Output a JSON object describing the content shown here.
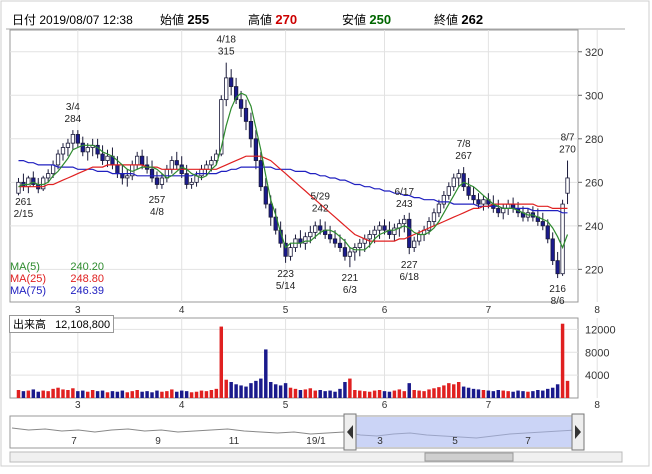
{
  "header": {
    "datetime_label": "日付",
    "datetime": "2019/08/07 12:38",
    "open_label": "始値",
    "open": "255",
    "high_label": "高値",
    "high": "270",
    "low_label": "安値",
    "low": "250",
    "close_label": "終値",
    "close": "262"
  },
  "colors": {
    "up": "#ffffff",
    "down": "#1a1a8c",
    "ma5": "#2e8b2e",
    "ma25": "#e02020",
    "ma75": "#2020c0",
    "vol_up": "#e02020",
    "vol_down": "#1a1a8c",
    "high_text": "#cc0000",
    "low_text": "#006600"
  },
  "ma_legend": [
    {
      "label": "MA(5)",
      "value": "240.20",
      "color": "#2e8b2e"
    },
    {
      "label": "MA(25)",
      "value": "248.80",
      "color": "#e02020"
    },
    {
      "label": "MA(75)",
      "value": "246.39",
      "color": "#2020c0"
    }
  ],
  "volume_label": {
    "label": "出来高",
    "value": "12,108,800"
  },
  "chart_data": {
    "type": "candlestick",
    "ylim": [
      205,
      330
    ],
    "yticks": [
      220,
      240,
      260,
      280,
      300,
      320
    ],
    "vol_ylim": [
      0,
      14000
    ],
    "vol_yticks": [
      4000,
      8000,
      12000
    ],
    "month_ticks": [
      {
        "label": "3",
        "index": 12
      },
      {
        "label": "4",
        "index": 33
      },
      {
        "label": "5",
        "index": 54
      },
      {
        "label": "6",
        "index": 74
      },
      {
        "label": "7",
        "index": 95
      },
      {
        "label": "8",
        "index": 117
      }
    ],
    "candles": [
      [
        255,
        262,
        254,
        260
      ],
      [
        260,
        264,
        256,
        258
      ],
      [
        258,
        263,
        255,
        262
      ],
      [
        262,
        265,
        258,
        259
      ],
      [
        259,
        262,
        255,
        257
      ],
      [
        257,
        263,
        256,
        262
      ],
      [
        262,
        266,
        260,
        264
      ],
      [
        264,
        270,
        262,
        268
      ],
      [
        268,
        275,
        266,
        273
      ],
      [
        273,
        278,
        270,
        276
      ],
      [
        276,
        280,
        272,
        278
      ],
      [
        278,
        284,
        275,
        282
      ],
      [
        282,
        284,
        276,
        278
      ],
      [
        278,
        281,
        272,
        274
      ],
      [
        274,
        278,
        270,
        276
      ],
      [
        276,
        280,
        272,
        277
      ],
      [
        277,
        280,
        271,
        273
      ],
      [
        273,
        277,
        268,
        270
      ],
      [
        270,
        275,
        267,
        272
      ],
      [
        272,
        276,
        266,
        268
      ],
      [
        268,
        272,
        262,
        264
      ],
      [
        264,
        268,
        259,
        262
      ],
      [
        262,
        266,
        258,
        263
      ],
      [
        263,
        270,
        261,
        268
      ],
      [
        268,
        274,
        266,
        272
      ],
      [
        272,
        275,
        266,
        268
      ],
      [
        268,
        272,
        264,
        266
      ],
      [
        266,
        270,
        260,
        262
      ],
      [
        262,
        265,
        257,
        259
      ],
      [
        259,
        264,
        257,
        262
      ],
      [
        262,
        268,
        260,
        266
      ],
      [
        266,
        272,
        264,
        270
      ],
      [
        270,
        274,
        266,
        268
      ],
      [
        268,
        272,
        262,
        264
      ],
      [
        264,
        268,
        257,
        259
      ],
      [
        259,
        262,
        257,
        260
      ],
      [
        260,
        265,
        258,
        263
      ],
      [
        263,
        268,
        261,
        266
      ],
      [
        266,
        270,
        263,
        268
      ],
      [
        268,
        272,
        265,
        270
      ],
      [
        270,
        275,
        268,
        273
      ],
      [
        273,
        300,
        272,
        298
      ],
      [
        298,
        315,
        295,
        308
      ],
      [
        308,
        312,
        300,
        304
      ],
      [
        304,
        308,
        296,
        298
      ],
      [
        298,
        302,
        290,
        294
      ],
      [
        294,
        298,
        284,
        288
      ],
      [
        288,
        292,
        276,
        280
      ],
      [
        280,
        284,
        266,
        270
      ],
      [
        270,
        274,
        256,
        258
      ],
      [
        258,
        262,
        248,
        250
      ],
      [
        250,
        254,
        240,
        244
      ],
      [
        244,
        248,
        236,
        238
      ],
      [
        238,
        242,
        230,
        232
      ],
      [
        232,
        236,
        223,
        226
      ],
      [
        226,
        232,
        224,
        230
      ],
      [
        230,
        236,
        228,
        234
      ],
      [
        234,
        238,
        230,
        232
      ],
      [
        232,
        237,
        229,
        235
      ],
      [
        235,
        240,
        232,
        237
      ],
      [
        237,
        242,
        234,
        240
      ],
      [
        240,
        243,
        236,
        238
      ],
      [
        238,
        242,
        234,
        236
      ],
      [
        236,
        240,
        232,
        234
      ],
      [
        234,
        238,
        230,
        232
      ],
      [
        232,
        236,
        228,
        230
      ],
      [
        230,
        234,
        224,
        226
      ],
      [
        226,
        230,
        221,
        228
      ],
      [
        228,
        232,
        224,
        230
      ],
      [
        230,
        234,
        226,
        232
      ],
      [
        232,
        236,
        228,
        234
      ],
      [
        234,
        238,
        230,
        236
      ],
      [
        236,
        240,
        232,
        238
      ],
      [
        238,
        242,
        234,
        240
      ],
      [
        240,
        243,
        236,
        238
      ],
      [
        238,
        242,
        234,
        236
      ],
      [
        236,
        241,
        233,
        239
      ],
      [
        239,
        243,
        235,
        241
      ],
      [
        241,
        245,
        237,
        243
      ],
      [
        243,
        246,
        227,
        230
      ],
      [
        230,
        235,
        228,
        233
      ],
      [
        233,
        238,
        231,
        236
      ],
      [
        236,
        240,
        233,
        238
      ],
      [
        238,
        244,
        236,
        242
      ],
      [
        242,
        248,
        240,
        246
      ],
      [
        246,
        252,
        244,
        250
      ],
      [
        250,
        256,
        248,
        254
      ],
      [
        254,
        260,
        252,
        258
      ],
      [
        258,
        264,
        256,
        262
      ],
      [
        262,
        266,
        258,
        264
      ],
      [
        264,
        267,
        256,
        258
      ],
      [
        258,
        262,
        252,
        254
      ],
      [
        254,
        258,
        250,
        252
      ],
      [
        252,
        255,
        248,
        250
      ],
      [
        250,
        254,
        247,
        252
      ],
      [
        252,
        255,
        248,
        250
      ],
      [
        250,
        254,
        246,
        248
      ],
      [
        248,
        252,
        244,
        246
      ],
      [
        246,
        250,
        243,
        248
      ],
      [
        248,
        252,
        245,
        250
      ],
      [
        250,
        253,
        246,
        248
      ],
      [
        248,
        251,
        244,
        246
      ],
      [
        246,
        249,
        242,
        244
      ],
      [
        244,
        248,
        242,
        246
      ],
      [
        246,
        249,
        242,
        244
      ],
      [
        244,
        248,
        240,
        242
      ],
      [
        242,
        246,
        238,
        240
      ],
      [
        240,
        243,
        232,
        234
      ],
      [
        234,
        237,
        222,
        224
      ],
      [
        224,
        228,
        216,
        218
      ],
      [
        218,
        252,
        217,
        250
      ],
      [
        255,
        270,
        250,
        262
      ]
    ],
    "volumes": [
      1400,
      1200,
      1300,
      1500,
      1100,
      1300,
      1200,
      1600,
      1800,
      1500,
      1400,
      1700,
      1200,
      1300,
      1100,
      1400,
      1200,
      1300,
      1000,
      1200,
      1100,
      1300,
      1000,
      1200,
      1400,
      1100,
      1200,
      1000,
      1300,
      1100,
      1200,
      1500,
      1100,
      1300,
      1200,
      1000,
      1100,
      1300,
      1200,
      1400,
      1600,
      12500,
      3200,
      2800,
      2400,
      2200,
      2000,
      2600,
      3000,
      3400,
      8500,
      2800,
      2400,
      2200,
      2600,
      1800,
      1600,
      1400,
      1500,
      1700,
      1300,
      1400,
      1200,
      1300,
      1100,
      1600,
      2800,
      3400,
      1400,
      1300,
      1200,
      1100,
      1300,
      1400,
      1200,
      1100,
      1300,
      1500,
      1200,
      2600,
      1400,
      1300,
      1200,
      1500,
      1700,
      1900,
      2200,
      2600,
      2400,
      2800,
      2000,
      1800,
      1600,
      1500,
      1400,
      1300,
      1200,
      1400,
      1300,
      1200,
      1100,
      1300,
      1200,
      1100,
      1200,
      1400,
      1300,
      1600,
      1800,
      2400,
      13000,
      3000
    ],
    "annotations": [
      {
        "date": "2/15",
        "value": "261",
        "index": 1,
        "pos": "below"
      },
      {
        "date": "3/4",
        "value": "284",
        "index": 11,
        "pos": "above"
      },
      {
        "date": "4/8",
        "value": "257",
        "index": 28,
        "pos": "below"
      },
      {
        "date": "4/18",
        "value": "315",
        "index": 42,
        "pos": "above"
      },
      {
        "date": "5/14",
        "value": "223",
        "index": 54,
        "pos": "below"
      },
      {
        "date": "5/29",
        "value": "242",
        "index": 61,
        "pos": "above"
      },
      {
        "date": "6/3",
        "value": "221",
        "index": 67,
        "pos": "below"
      },
      {
        "date": "6/17",
        "value": "243",
        "index": 78,
        "pos": "above"
      },
      {
        "date": "6/18",
        "value": "227",
        "index": 79,
        "pos": "below"
      },
      {
        "date": "7/8",
        "value": "267",
        "index": 90,
        "pos": "above"
      },
      {
        "date": "8/6",
        "value": "216",
        "index": 109,
        "pos": "below"
      },
      {
        "date": "8/7",
        "value": "270",
        "index": 111,
        "pos": "above"
      }
    ],
    "ma5": [
      258,
      259,
      259,
      260,
      259,
      259,
      260,
      263,
      265,
      268,
      271,
      275,
      276,
      277,
      277,
      277,
      276,
      274,
      273,
      272,
      270,
      268,
      266,
      265,
      266,
      267,
      267,
      267,
      266,
      264,
      262,
      263,
      265,
      267,
      266,
      264,
      263,
      262,
      263,
      266,
      268,
      276,
      286,
      294,
      299,
      301,
      300,
      295,
      285,
      275,
      263,
      252,
      245,
      237,
      230,
      232,
      232,
      232,
      233,
      233,
      235,
      237,
      238,
      238,
      237,
      235,
      233,
      230,
      229,
      229,
      229,
      231,
      234,
      236,
      237,
      238,
      238,
      239,
      240,
      239,
      237,
      236,
      236,
      237,
      239,
      242,
      246,
      250,
      254,
      258,
      260,
      259,
      258,
      256,
      254,
      252,
      250,
      249,
      248,
      248,
      248,
      247,
      246,
      245,
      245,
      244,
      243,
      242,
      239,
      235,
      230,
      236,
      240
    ],
    "ma25": [
      258,
      258,
      258,
      258,
      258,
      258,
      259,
      259,
      260,
      261,
      262,
      263,
      264,
      265,
      266,
      267,
      267,
      267,
      268,
      268,
      268,
      268,
      268,
      268,
      268,
      268,
      267,
      267,
      267,
      266,
      266,
      266,
      266,
      266,
      266,
      266,
      266,
      266,
      266,
      266,
      266,
      267,
      268,
      269,
      270,
      271,
      272,
      272,
      272,
      272,
      271,
      270,
      268,
      266,
      264,
      262,
      260,
      258,
      256,
      254,
      252,
      250,
      248,
      246,
      244,
      242,
      240,
      238,
      236,
      235,
      234,
      233,
      233,
      233,
      233,
      233,
      233,
      234,
      234,
      235,
      236,
      237,
      238,
      239,
      240,
      241,
      242,
      243,
      244,
      245,
      246,
      247,
      248,
      248,
      249,
      249,
      250,
      250,
      250,
      250,
      250,
      250,
      250,
      250,
      250,
      249,
      249,
      249,
      248,
      248,
      248,
      248,
      248
    ],
    "ma75": [
      270,
      270,
      269,
      269,
      268,
      268,
      268,
      268,
      267,
      267,
      267,
      267,
      266,
      266,
      266,
      266,
      265,
      265,
      265,
      264,
      264,
      264,
      264,
      264,
      263,
      263,
      263,
      263,
      263,
      263,
      263,
      263,
      263,
      263,
      263,
      263,
      264,
      264,
      264,
      264,
      264,
      265,
      265,
      266,
      266,
      267,
      267,
      267,
      267,
      267,
      267,
      267,
      266,
      266,
      266,
      266,
      265,
      265,
      265,
      264,
      264,
      263,
      263,
      262,
      262,
      261,
      261,
      260,
      259,
      259,
      258,
      258,
      257,
      257,
      256,
      256,
      255,
      255,
      254,
      254,
      253,
      253,
      252,
      252,
      252,
      251,
      251,
      251,
      250,
      250,
      250,
      250,
      250,
      249,
      249,
      249,
      249,
      249,
      248,
      248,
      248,
      248,
      248,
      248,
      247,
      247,
      247,
      247,
      247,
      247,
      246,
      246,
      246
    ],
    "overview": {
      "labels": [
        {
          "label": "7",
          "x": 74
        },
        {
          "label": "9",
          "x": 158
        },
        {
          "label": "11",
          "x": 234
        },
        {
          "label": "19/1",
          "x": 316
        },
        {
          "label": "3",
          "x": 380
        },
        {
          "label": "5",
          "x": 455
        },
        {
          "label": "7",
          "x": 528
        }
      ]
    }
  }
}
